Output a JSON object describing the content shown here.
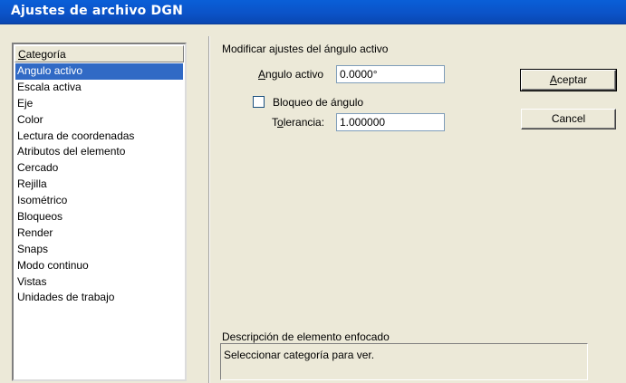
{
  "window": {
    "title": "Ajustes de archivo DGN"
  },
  "categories": {
    "header_prefix": "C",
    "header_rest": "ategoría",
    "items": [
      {
        "label": "Angulo activo",
        "selected": true
      },
      {
        "label": "Escala activa"
      },
      {
        "label": "Eje"
      },
      {
        "label": "Color"
      },
      {
        "label": "Lectura de coordenadas"
      },
      {
        "label": "Atributos del elemento"
      },
      {
        "label": "Cercado"
      },
      {
        "label": "Rejilla"
      },
      {
        "label": "Isométrico"
      },
      {
        "label": "Bloqueos"
      },
      {
        "label": "Render"
      },
      {
        "label": "Snaps"
      },
      {
        "label": "Modo continuo"
      },
      {
        "label": "Vistas"
      },
      {
        "label": "Unidades de trabajo"
      }
    ]
  },
  "panel": {
    "section_title": "Modificar ajustes del ángulo activo",
    "active_angle": {
      "label_prefix": "A",
      "label_rest": "ngulo activo",
      "value": "0.0000°"
    },
    "angle_lock": {
      "label_pre": "Bloqueo de án",
      "label_u": "g",
      "label_post": "ulo",
      "checked": false
    },
    "tolerance": {
      "label_pre": "T",
      "label_u": "o",
      "label_post": "lerancia:",
      "value": "1.000000"
    }
  },
  "buttons": {
    "accept_u": "A",
    "accept_rest": "ceptar",
    "cancel": "Cancel"
  },
  "description": {
    "label": "Descripción de elemento enfocado",
    "text": "Seleccionar categoría para ver."
  }
}
